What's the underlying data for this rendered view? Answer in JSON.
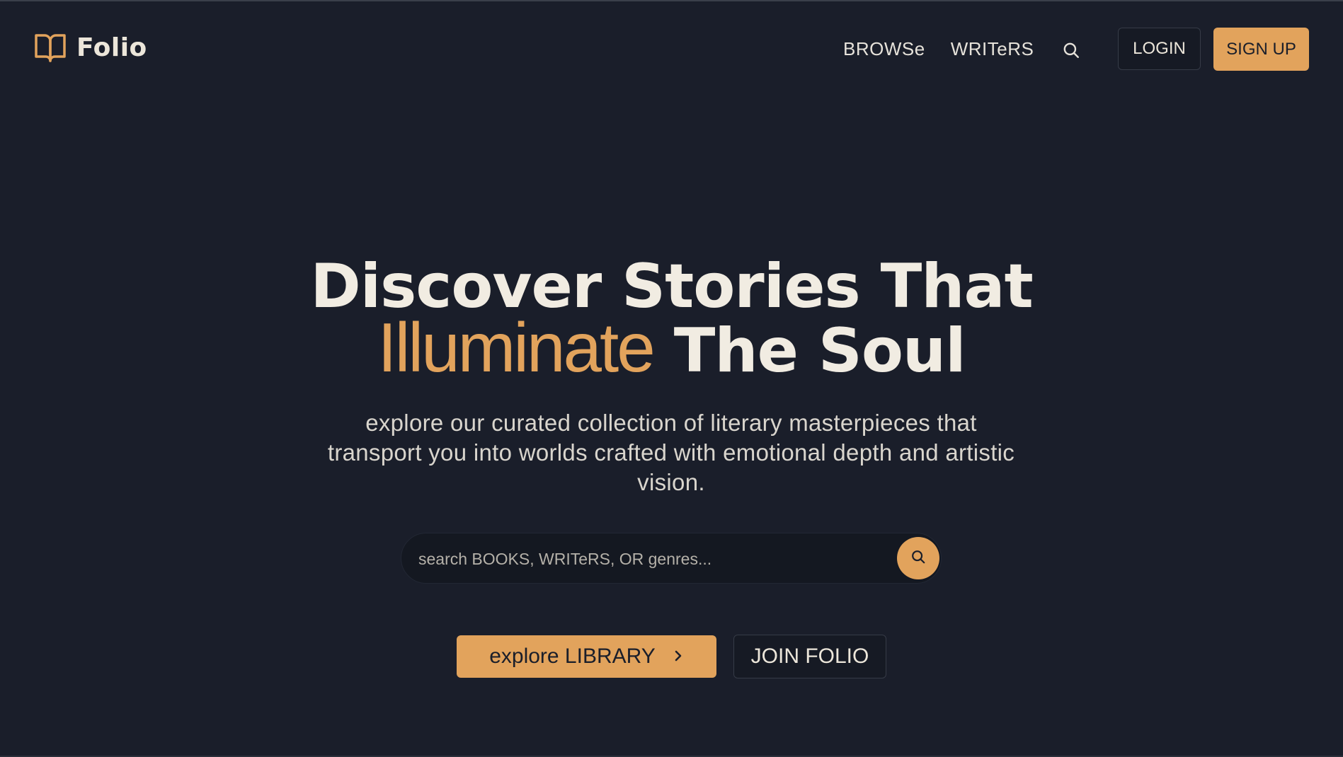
{
  "brand": {
    "name": "Folio",
    "accent_color": "#e2a35c",
    "background_color": "#1a1e2a",
    "icon": "open-book-icon"
  },
  "nav": {
    "links": [
      {
        "label": "BROWSe"
      },
      {
        "label": "WRITeRS"
      }
    ],
    "search_icon": "search-icon",
    "login_label": "LOGIN",
    "signup_label": "SIGN UP"
  },
  "hero": {
    "title_line1": "Discover Stories That",
    "title_accent": "Illuminate",
    "title_rest": "The Soul",
    "subtitle": "explore our curated collection of literary masterpieces that transport you into worlds crafted with emotional depth and artistic vision."
  },
  "search": {
    "placeholder": "search BOOKS, WRITeRS, OR genres...",
    "submit_icon": "search-icon"
  },
  "cta": {
    "explore_label": "explore LIBRARY",
    "explore_icon": "chevron-right-icon",
    "join_label": "JOIN FOLIO"
  }
}
